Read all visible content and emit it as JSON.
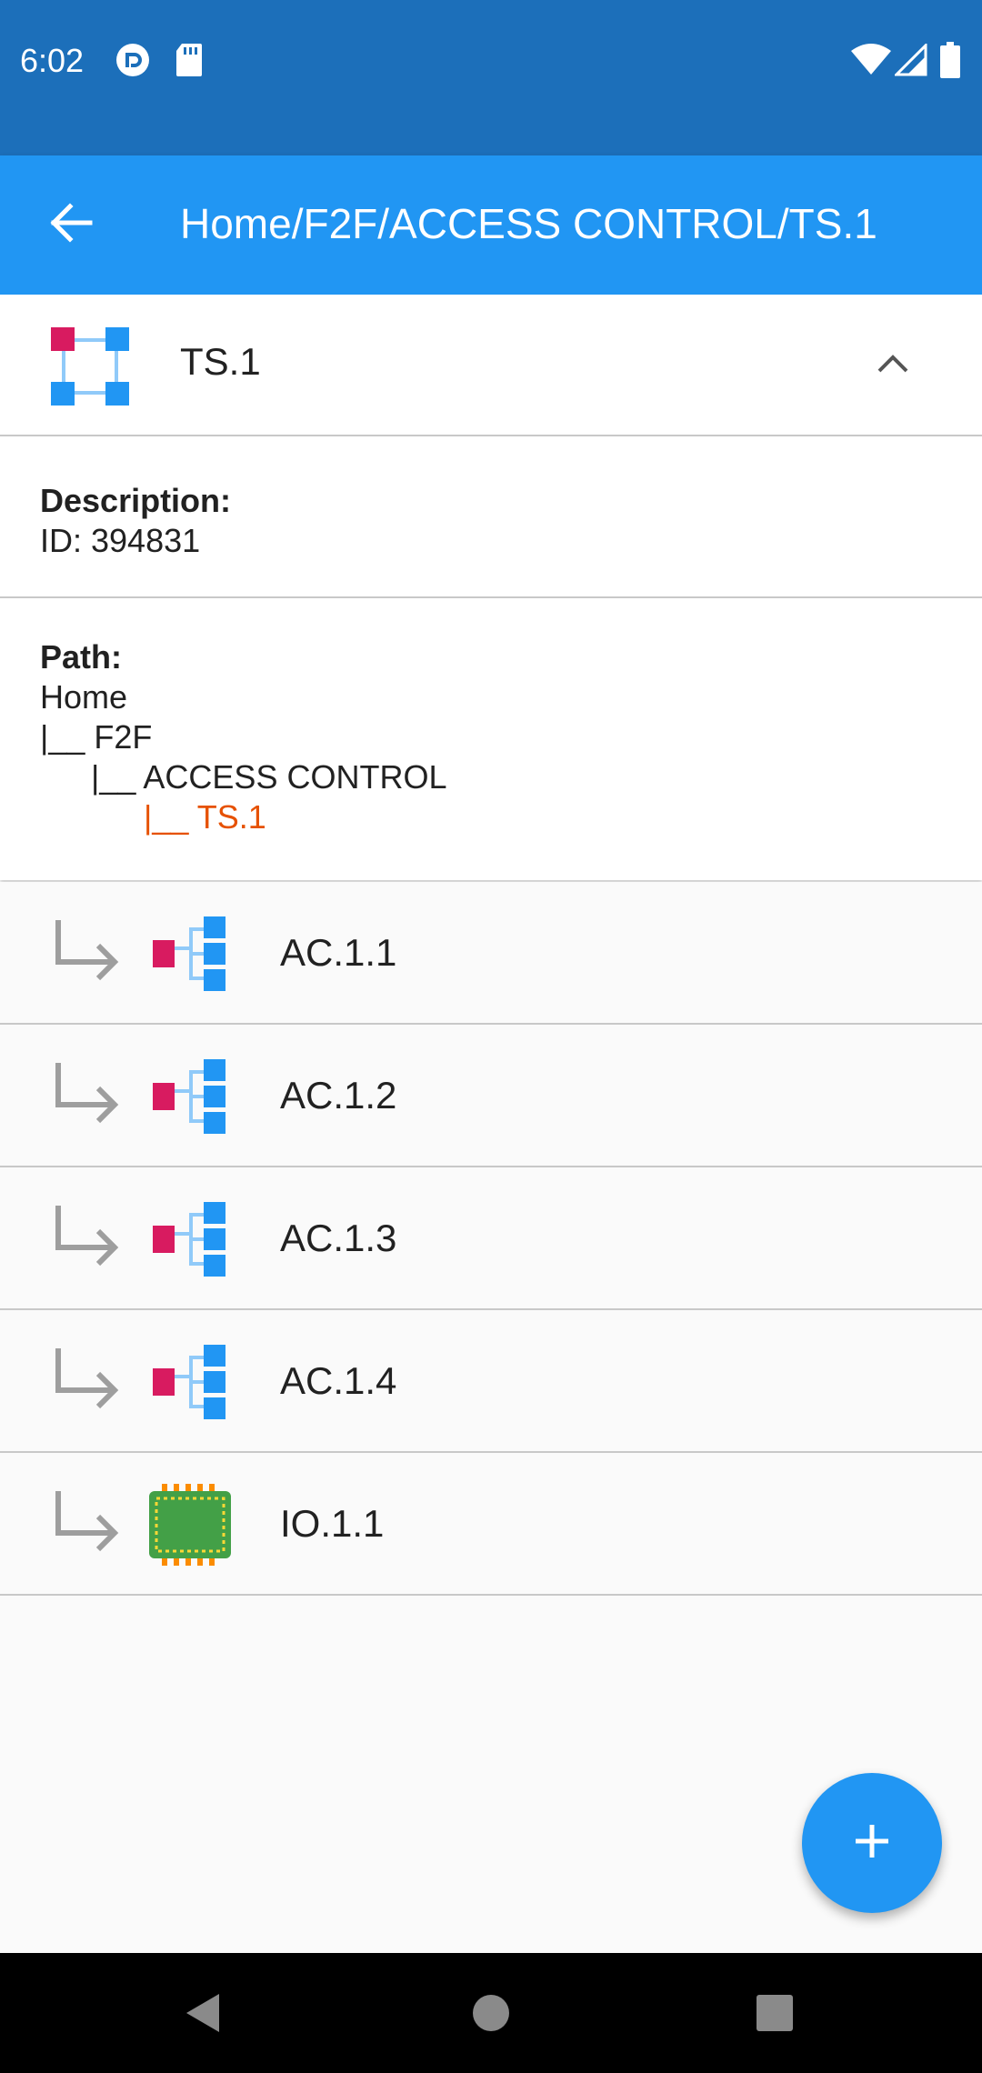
{
  "status_bar": {
    "time": "6:02",
    "left_icons": [
      "pocket-casts-icon",
      "sd-card-icon"
    ],
    "right_icons": [
      "wifi-icon",
      "signal-icon",
      "battery-icon"
    ]
  },
  "app_bar": {
    "back_icon": "arrow-back-icon",
    "title": "Home/F2F/ACCESS CONTROL/TS.1",
    "color": "#2196f3"
  },
  "detail": {
    "title": "TS.1",
    "icon": "ts-node-icon",
    "collapse_icon": "chevron-up-icon",
    "description_label": "Description:",
    "description_value": "ID: 394831",
    "path_label": "Path:",
    "path_lines": [
      "Home",
      "|__ F2F",
      "|__ ACCESS CONTROL",
      "|__ TS.1"
    ],
    "path_current_color": "#e65100"
  },
  "children": [
    {
      "label": "AC.1.1",
      "icon": "access-control-icon"
    },
    {
      "label": "AC.1.2",
      "icon": "access-control-icon"
    },
    {
      "label": "AC.1.3",
      "icon": "access-control-icon"
    },
    {
      "label": "AC.1.4",
      "icon": "access-control-icon"
    },
    {
      "label": "IO.1.1",
      "icon": "io-chip-icon"
    }
  ],
  "fab": {
    "icon": "plus-icon"
  },
  "nav_bar": {
    "icons": [
      "back-triangle-icon",
      "home-circle-icon",
      "recents-square-icon"
    ]
  }
}
